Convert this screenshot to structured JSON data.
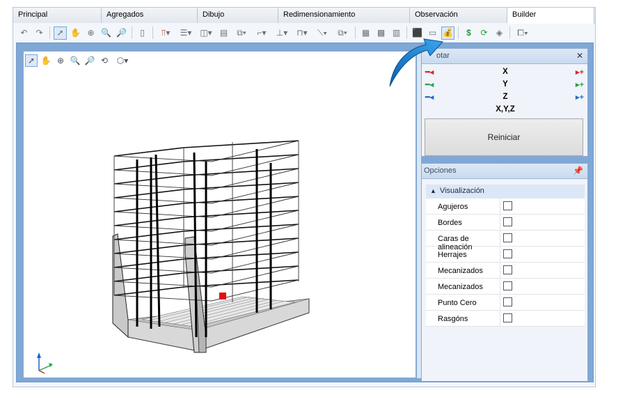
{
  "tabs": [
    {
      "label": "Principal",
      "width": 127
    },
    {
      "label": "Agregados",
      "width": 138
    },
    {
      "label": "Dibujo",
      "width": 116
    },
    {
      "label": "Redimensionamiento",
      "width": 189
    },
    {
      "label": "Observación",
      "width": 140
    },
    {
      "label": "Builder",
      "width": 125
    }
  ],
  "active_tab": "Builder",
  "rotate_panel": {
    "title_visible": "otar",
    "rows": [
      {
        "left": "━◂",
        "center": "X",
        "right": "▸+",
        "left_color": "#d42a2a",
        "right_color": "#d42a2a"
      },
      {
        "left": "━◂",
        "center": "Y",
        "right": "▸+",
        "left_color": "#2aa24a",
        "right_color": "#2aa24a"
      },
      {
        "left": "━◂",
        "center": "Z",
        "right": "▸+",
        "left_color": "#2a6cc4",
        "right_color": "#2a6cc4"
      },
      {
        "left": "",
        "center": "X,Y,Z",
        "right": ""
      }
    ],
    "reset_label": "Reiniciar",
    "close_glyph": "✕"
  },
  "options_panel": {
    "title": "Opciones",
    "pin_glyph": "📌",
    "category": "Visualización",
    "properties": [
      "Agujeros",
      "Bordes",
      "Caras de alineación",
      "Herrajes",
      "Mecanizados",
      "Mecanizados",
      "Punto Cero",
      "Rasgóns"
    ]
  },
  "colors": {
    "accent_blue": "#7fa8d6",
    "arrow_blue": "#2c8ed8",
    "marker_red": "#e01010"
  }
}
